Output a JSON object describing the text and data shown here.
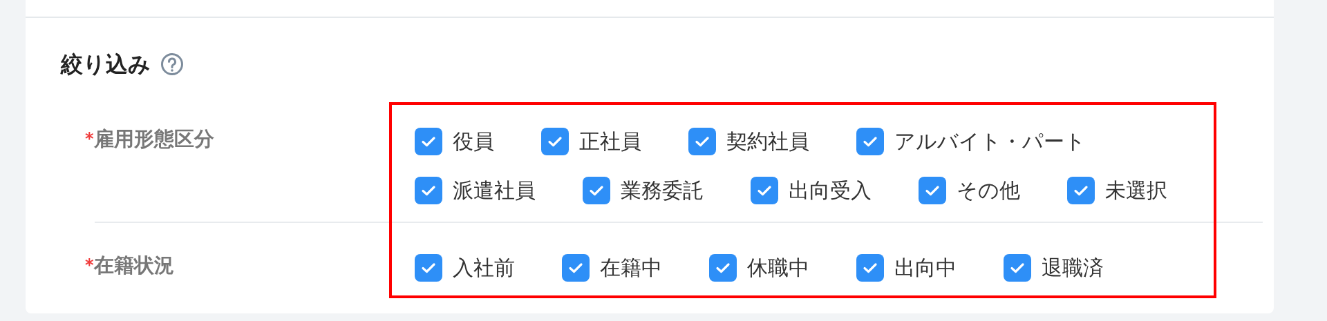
{
  "title": "絞り込み",
  "sections": [
    {
      "required_mark": "*",
      "label": "雇用形態区分",
      "option_rows": [
        [
          {
            "label": "役員",
            "checked": true
          },
          {
            "label": "正社員",
            "checked": true
          },
          {
            "label": "契約社員",
            "checked": true
          },
          {
            "label": "アルバイト・パート",
            "checked": true
          }
        ],
        [
          {
            "label": "派遣社員",
            "checked": true
          },
          {
            "label": "業務委託",
            "checked": true
          },
          {
            "label": "出向受入",
            "checked": true
          },
          {
            "label": "その他",
            "checked": true
          },
          {
            "label": "未選択",
            "checked": true
          }
        ]
      ]
    },
    {
      "required_mark": "*",
      "label": "在籍状況",
      "option_rows": [
        [
          {
            "label": "入社前",
            "checked": true
          },
          {
            "label": "在籍中",
            "checked": true
          },
          {
            "label": "休職中",
            "checked": true
          },
          {
            "label": "出向中",
            "checked": true
          },
          {
            "label": "退職済",
            "checked": true
          }
        ]
      ]
    }
  ]
}
